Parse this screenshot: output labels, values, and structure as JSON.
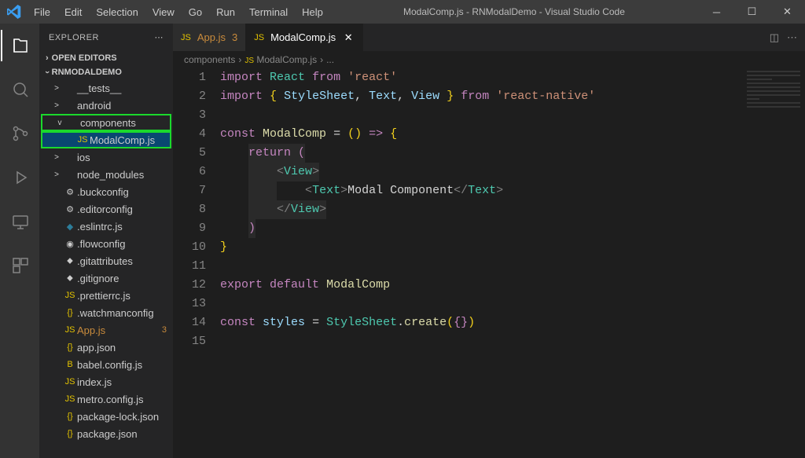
{
  "title": "ModalComp.js - RNModalDemo - Visual Studio Code",
  "menu": [
    "File",
    "Edit",
    "Selection",
    "View",
    "Go",
    "Run",
    "Terminal",
    "Help"
  ],
  "explorer": {
    "title": "EXPLORER",
    "openEditors": "OPEN EDITORS",
    "project": "RNMODALDEMO"
  },
  "tree": [
    {
      "indent": 1,
      "chev": ">",
      "icon": "",
      "label": "__tests__",
      "cls": ""
    },
    {
      "indent": 1,
      "chev": ">",
      "icon": "",
      "label": "android",
      "cls": ""
    },
    {
      "indent": 1,
      "chev": "v",
      "icon": "",
      "label": "components",
      "cls": "highlighted",
      "hl": true
    },
    {
      "indent": 2,
      "chev": "",
      "icon": "JS",
      "iconCls": "yellow",
      "label": "ModalComp.js",
      "cls": "highlighted selected",
      "hl": true
    },
    {
      "indent": 1,
      "chev": ">",
      "icon": "",
      "label": "ios",
      "cls": ""
    },
    {
      "indent": 1,
      "chev": ">",
      "icon": "",
      "label": "node_modules",
      "cls": ""
    },
    {
      "indent": 1,
      "chev": "",
      "icon": "⚙",
      "iconCls": "",
      "label": ".buckconfig",
      "cls": ""
    },
    {
      "indent": 1,
      "chev": "",
      "icon": "⚙",
      "iconCls": "",
      "label": ".editorconfig",
      "cls": ""
    },
    {
      "indent": 1,
      "chev": "",
      "icon": "◆",
      "iconCls": "teal",
      "label": ".eslintrc.js",
      "cls": ""
    },
    {
      "indent": 1,
      "chev": "",
      "icon": "◉",
      "iconCls": "",
      "label": ".flowconfig",
      "cls": ""
    },
    {
      "indent": 1,
      "chev": "",
      "icon": "⬥",
      "iconCls": "",
      "label": ".gitattributes",
      "cls": ""
    },
    {
      "indent": 1,
      "chev": "",
      "icon": "⬥",
      "iconCls": "",
      "label": ".gitignore",
      "cls": ""
    },
    {
      "indent": 1,
      "chev": "",
      "icon": "JS",
      "iconCls": "yellow",
      "label": ".prettierrc.js",
      "cls": ""
    },
    {
      "indent": 1,
      "chev": "",
      "icon": "{}",
      "iconCls": "yellow",
      "label": ".watchmanconfig",
      "cls": ""
    },
    {
      "indent": 1,
      "chev": "",
      "icon": "JS",
      "iconCls": "yellow",
      "label": "App.js",
      "cls": "",
      "labelCls": "orange",
      "badge": "3"
    },
    {
      "indent": 1,
      "chev": "",
      "icon": "{}",
      "iconCls": "yellow",
      "label": "app.json",
      "cls": ""
    },
    {
      "indent": 1,
      "chev": "",
      "icon": "B",
      "iconCls": "yellow",
      "label": "babel.config.js",
      "cls": ""
    },
    {
      "indent": 1,
      "chev": "",
      "icon": "JS",
      "iconCls": "yellow",
      "label": "index.js",
      "cls": ""
    },
    {
      "indent": 1,
      "chev": "",
      "icon": "JS",
      "iconCls": "yellow",
      "label": "metro.config.js",
      "cls": ""
    },
    {
      "indent": 1,
      "chev": "",
      "icon": "{}",
      "iconCls": "yellow",
      "label": "package-lock.json",
      "cls": ""
    },
    {
      "indent": 1,
      "chev": "",
      "icon": "{}",
      "iconCls": "yellow",
      "label": "package.json",
      "cls": ""
    }
  ],
  "tabs": [
    {
      "icon": "JS",
      "label": "App.js",
      "badge": "3",
      "active": false,
      "labelCls": "orange"
    },
    {
      "icon": "JS",
      "label": "ModalComp.js",
      "badge": "",
      "active": true,
      "close": "✕"
    }
  ],
  "breadcrumb": [
    "components",
    "ModalComp.js",
    "..."
  ],
  "codeLines": [
    {
      "n": 1,
      "html": "<span class='kw'>import</span> <span class='ty'>React</span> <span class='kw'>from</span> <span class='str'>'react'</span>"
    },
    {
      "n": 2,
      "html": "<span class='kw'>import</span> <span class='br1'>{</span> <span class='var'>StyleSheet</span><span class='pn'>,</span> <span class='var'>Text</span><span class='pn'>,</span> <span class='var'>View</span> <span class='br1'>}</span> <span class='kw'>from</span> <span class='str'>'react-native'</span>"
    },
    {
      "n": 3,
      "html": ""
    },
    {
      "n": 4,
      "html": "<span class='kw'>const</span> <span class='fn'>ModalComp</span> <span class='pn'>=</span> <span class='br1'>()</span> <span class='kw'>=&gt;</span> <span class='br1'>{</span>"
    },
    {
      "n": 5,
      "html": "    <span class='dim-block'><span class='kw'>return</span> <span class='br2'>(</span></span>"
    },
    {
      "n": 6,
      "html": "    <span class='dim-block'>    <span class='ang'>&lt;</span><span class='tag'>View</span><span class='ang'>&gt;</span></span>"
    },
    {
      "n": 7,
      "html": "    <span class='dim-block'>    </span>    <span class='ang'>&lt;</span><span class='tag'>Text</span><span class='ang'>&gt;</span>Modal Component<span class='ang'>&lt;/</span><span class='tag'>Text</span><span class='ang'>&gt;</span>"
    },
    {
      "n": 8,
      "html": "    <span class='dim-block'>    <span class='ang'>&lt;/</span><span class='tag'>View</span><span class='ang'>&gt;</span></span>"
    },
    {
      "n": 9,
      "html": "    <span class='dim-block'><span class='br2'>)</span></span>"
    },
    {
      "n": 10,
      "html": "<span class='br1'>}</span>"
    },
    {
      "n": 11,
      "html": ""
    },
    {
      "n": 12,
      "html": "<span class='kw'>export</span> <span class='kw'>default</span> <span class='fn'>ModalComp</span>"
    },
    {
      "n": 13,
      "html": ""
    },
    {
      "n": 14,
      "html": "<span class='kw'>const</span> <span class='var'>styles</span> <span class='pn'>=</span> <span class='ty'>StyleSheet</span><span class='pn'>.</span><span class='fn'>create</span><span class='br1'>(</span><span class='br2'>{}</span><span class='br1'>)</span>"
    },
    {
      "n": 15,
      "html": ""
    }
  ]
}
